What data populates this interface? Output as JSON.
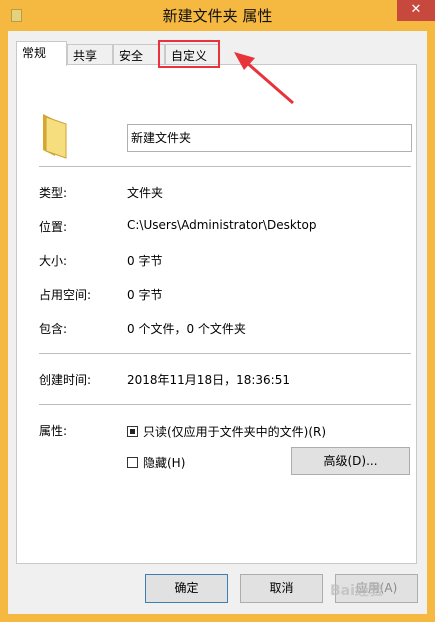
{
  "window": {
    "title": "新建文件夹 属性",
    "close_glyph": "✕",
    "accent": "#f5b941"
  },
  "tabs": [
    {
      "label": "常规",
      "active": true
    },
    {
      "label": "共享",
      "active": false
    },
    {
      "label": "安全",
      "active": false
    },
    {
      "label": "自定义",
      "active": false
    }
  ],
  "general": {
    "folder_name": "新建文件夹",
    "rows": [
      {
        "label": "类型:",
        "value": "文件夹"
      },
      {
        "label": "位置:",
        "value": "C:\\Users\\Administrator\\Desktop"
      },
      {
        "label": "大小:",
        "value": "0 字节"
      },
      {
        "label": "占用空间:",
        "value": "0 字节"
      },
      {
        "label": "包含:",
        "value": "0 个文件，0 个文件夹"
      }
    ],
    "created_label": "创建时间:",
    "created_value": "2018年11月18日，18:36:51",
    "attributes_label": "属性:",
    "readonly_label": "只读(仅应用于文件夹中的文件)(R)",
    "readonly_checked": true,
    "hidden_label": "隐藏(H)",
    "hidden_checked": false,
    "advanced_button": "高级(D)..."
  },
  "footer": {
    "ok": "确定",
    "cancel": "取消",
    "apply": "应用(A)"
  },
  "annotation": {
    "color": "#e8333a",
    "target": "自定义"
  },
  "watermark": "Bai经验"
}
